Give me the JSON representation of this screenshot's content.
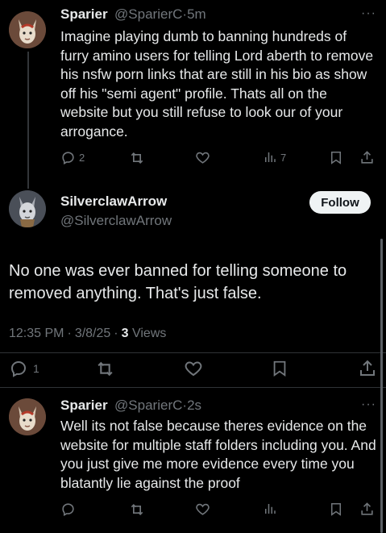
{
  "tweet1": {
    "name": "Sparier",
    "handle": "@SparierC",
    "time": "5m",
    "text": "Imagine playing dumb to banning hundreds of furry amino users for telling Lord aberth to remove his nsfw porn links that are still in his bio as show off his \"semi agent\" profile. Thats all on the website but you still refuse to look our of your arrogance.",
    "reply_count": "2",
    "views_count": "7"
  },
  "main_tweet": {
    "name": "SilverclawArrow",
    "handle": "@SilverclawArrow",
    "follow_label": "Follow",
    "text": "No one was ever banned for telling someone to removed anything. That's just false.",
    "time": "12:35 PM",
    "date": "3/8/25",
    "views_count": "3",
    "views_label": "Views",
    "reply_count": "1"
  },
  "tweet3": {
    "name": "Sparier",
    "handle": "@SparierC",
    "time": "2s",
    "text": "Well its not false because theres evidence on the website for multiple staff folders including you. And you just give me more evidence every time you blatantly lie against the proof"
  },
  "sep": "·",
  "more": "···",
  "colors": {
    "background": "#000000",
    "text": "#e7e9ea",
    "muted": "#71767b",
    "divider": "#2f3336",
    "follow_bg": "#eff3f4"
  }
}
